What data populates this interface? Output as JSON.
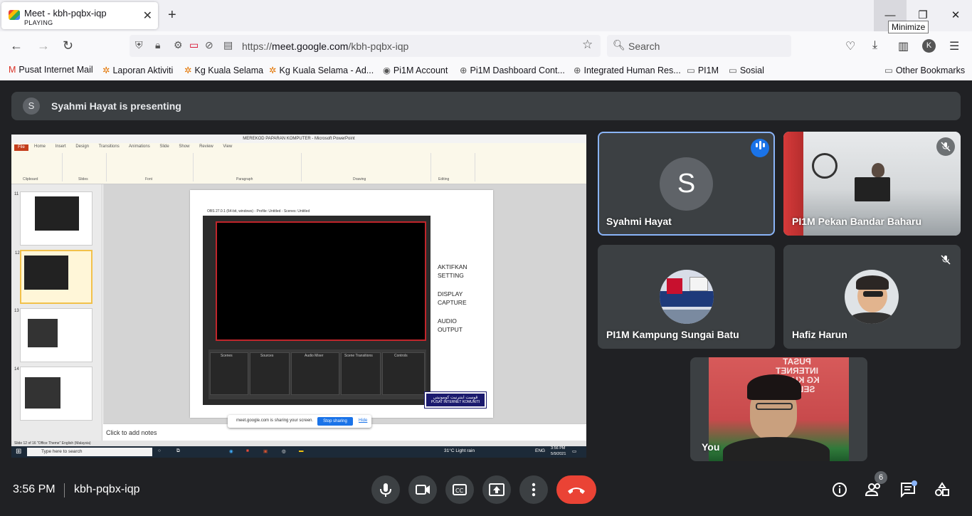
{
  "browser": {
    "tab_title": "Meet - kbh-pqbx-iqp",
    "tab_status": "PLAYING",
    "tooltip": "Minimize",
    "url_prefix": "https://",
    "url_domain": "meet.google.com",
    "url_path": "/kbh-pqbx-iqp",
    "search_placeholder": "Search",
    "profile_initial": "K",
    "bookmarks": [
      "Pusat Internet Mail",
      "Laporan Aktiviti",
      "Kg Kuala Selama",
      "Kg Kuala Selama - Ad...",
      "Pi1M Account",
      "Pi1M Dashboard Cont...",
      "Integrated Human Res...",
      "PI1M",
      "Sosial"
    ],
    "other_bookmarks": "Other Bookmarks"
  },
  "meet": {
    "presenting_initial": "S",
    "presenting_text": "Syahmi Hayat is presenting",
    "participants": [
      {
        "name": "Syahmi Hayat",
        "initial": "S",
        "speaking": true
      },
      {
        "name": "PI1M Pekan Bandar Baharu",
        "muted": true
      },
      {
        "name": "PI1M Kampung Sungai Batu"
      },
      {
        "name": "Hafiz Harun",
        "muted": true
      },
      {
        "name": "You"
      }
    ],
    "time": "3:56 PM",
    "meeting_code": "kbh-pqbx-iqp",
    "people_count": "6"
  },
  "shared_screen": {
    "window_title": "MEREKOD PAPARAN KOMPUTER - Microsoft PowerPoint",
    "file_tab": "File",
    "ribbon_tabs": "Home Insert Design Transitions Animations Slide Show Review View",
    "ribbon_groups": [
      "Clipboard",
      "Slides",
      "Font",
      "Paragraph",
      "Drawing",
      "Editing"
    ],
    "slide_numbers": [
      "11",
      "12",
      "13",
      "14"
    ],
    "slide_text": [
      "AKTIFKAN SETTING",
      "DISPLAY CAPTURE",
      "AUDIO OUTPUT"
    ],
    "obs_title": "OBS 27.0.1 (64-bit, windows) - Profile: Untitled - Scenes: Untitled",
    "obs_docks": [
      "Scenes",
      "Sources",
      "Audio Mixer",
      "Scene Transitions",
      "Controls"
    ],
    "logo_text": "PUSAT INTERNET KOMUNITI",
    "notes_placeholder": "Click to add notes",
    "share_text": "meet.google.com is sharing your screen.",
    "stop_sharing": "Stop sharing",
    "hide": "Hide",
    "status_text": "Slide 12 of 16   \"Office Theme\"   English (Malaysia)",
    "taskbar_search": "Type here to search",
    "weather": "31°C  Light rain",
    "lang": "ENG",
    "tb_time": "3:56 PM",
    "tb_date": "5/9/2021"
  }
}
